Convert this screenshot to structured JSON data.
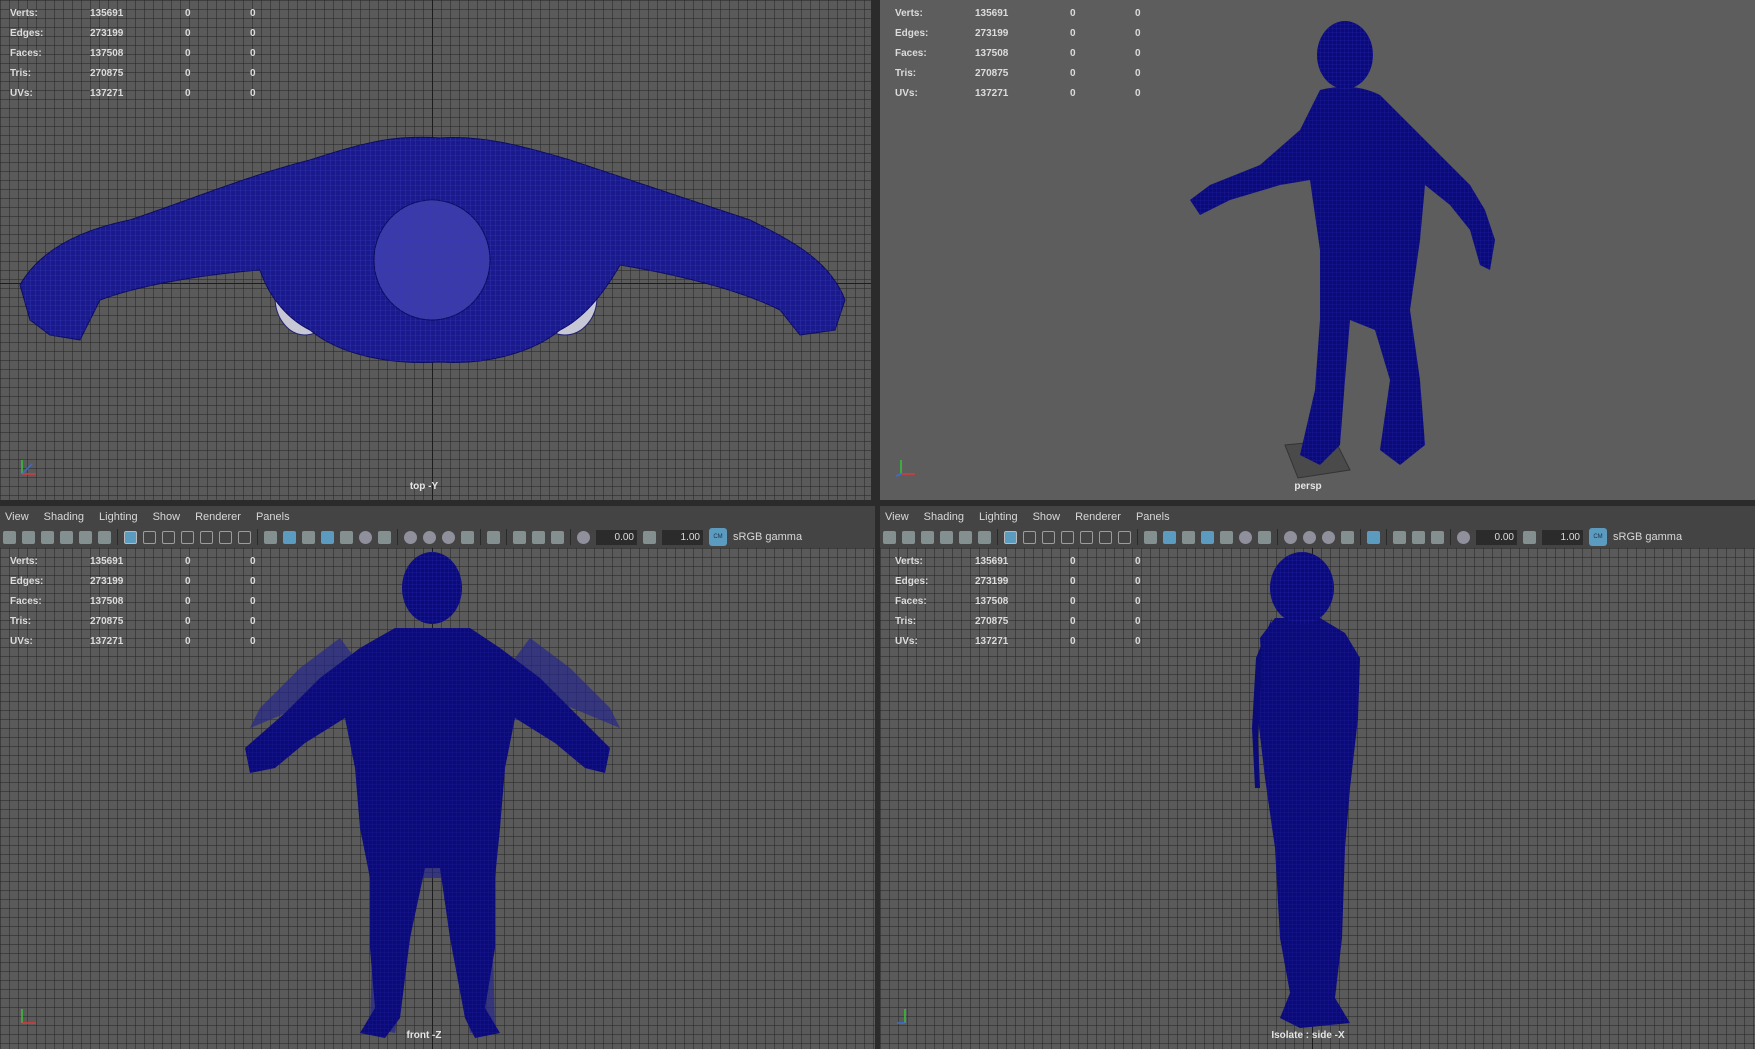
{
  "stats": [
    {
      "label": "Verts:",
      "v1": "135691",
      "v2": "0",
      "v3": "0"
    },
    {
      "label": "Edges:",
      "v1": "273199",
      "v2": "0",
      "v3": "0"
    },
    {
      "label": "Faces:",
      "v1": "137508",
      "v2": "0",
      "v3": "0"
    },
    {
      "label": "Tris:",
      "v1": "270875",
      "v2": "0",
      "v3": "0"
    },
    {
      "label": "UVs:",
      "v1": "137271",
      "v2": "0",
      "v3": "0"
    }
  ],
  "viewports": {
    "top": {
      "camera": "top -Y"
    },
    "persp": {
      "camera": "persp"
    },
    "front": {
      "camera": "front -Z"
    },
    "side": {
      "camera": "Isolate : side -X"
    }
  },
  "menu": {
    "view": "View",
    "shading": "Shading",
    "lighting": "Lighting",
    "show": "Show",
    "renderer": "Renderer",
    "panels": "Panels"
  },
  "toolbar": {
    "exposure": "0.00",
    "gamma": "1.00",
    "colorspace": "sRGB gamma",
    "cm_badge": "CM"
  },
  "colors": {
    "mesh": "#0b0b78",
    "wire": "#2a2ab0",
    "viewport_bg": "#5a5a5a"
  }
}
